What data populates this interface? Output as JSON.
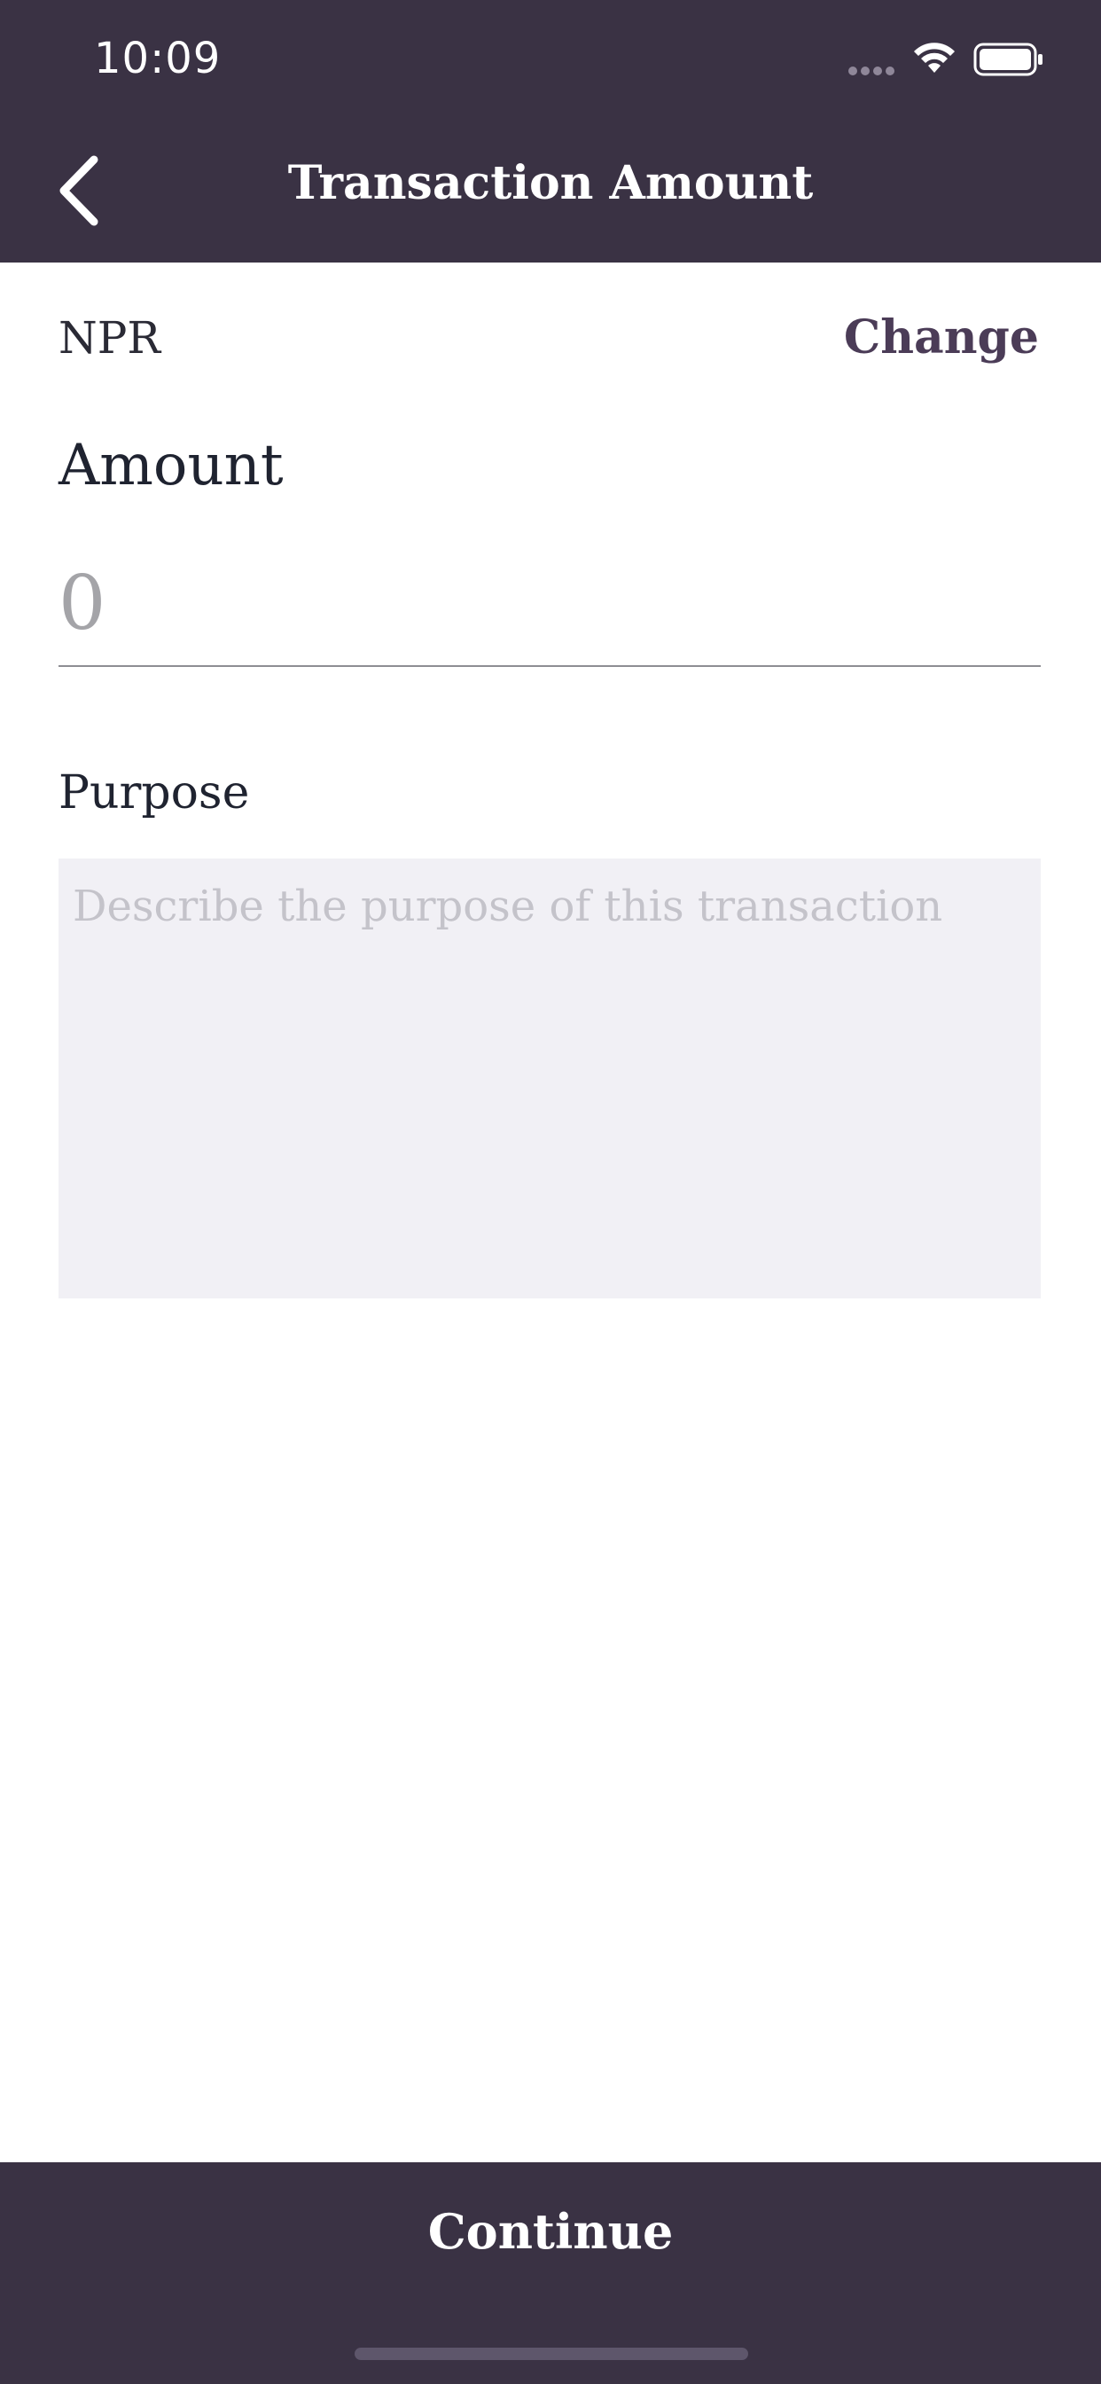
{
  "status_bar": {
    "time": "10:09",
    "icons": [
      "signal-icon",
      "wifi-icon",
      "battery-icon"
    ]
  },
  "header": {
    "title": "Transaction Amount",
    "back_icon": "chevron-left-icon"
  },
  "currency": {
    "code": "NPR",
    "change_label": "Change"
  },
  "amount": {
    "label": "Amount",
    "placeholder": "0",
    "value": ""
  },
  "purpose": {
    "label": "Purpose",
    "placeholder": "Describe the purpose of this transaction",
    "value": ""
  },
  "footer": {
    "continue_label": "Continue"
  },
  "colors": {
    "header_bg": "#3a3244",
    "accent": "#4b3c57",
    "textarea_bg": "#f1f0f5"
  }
}
